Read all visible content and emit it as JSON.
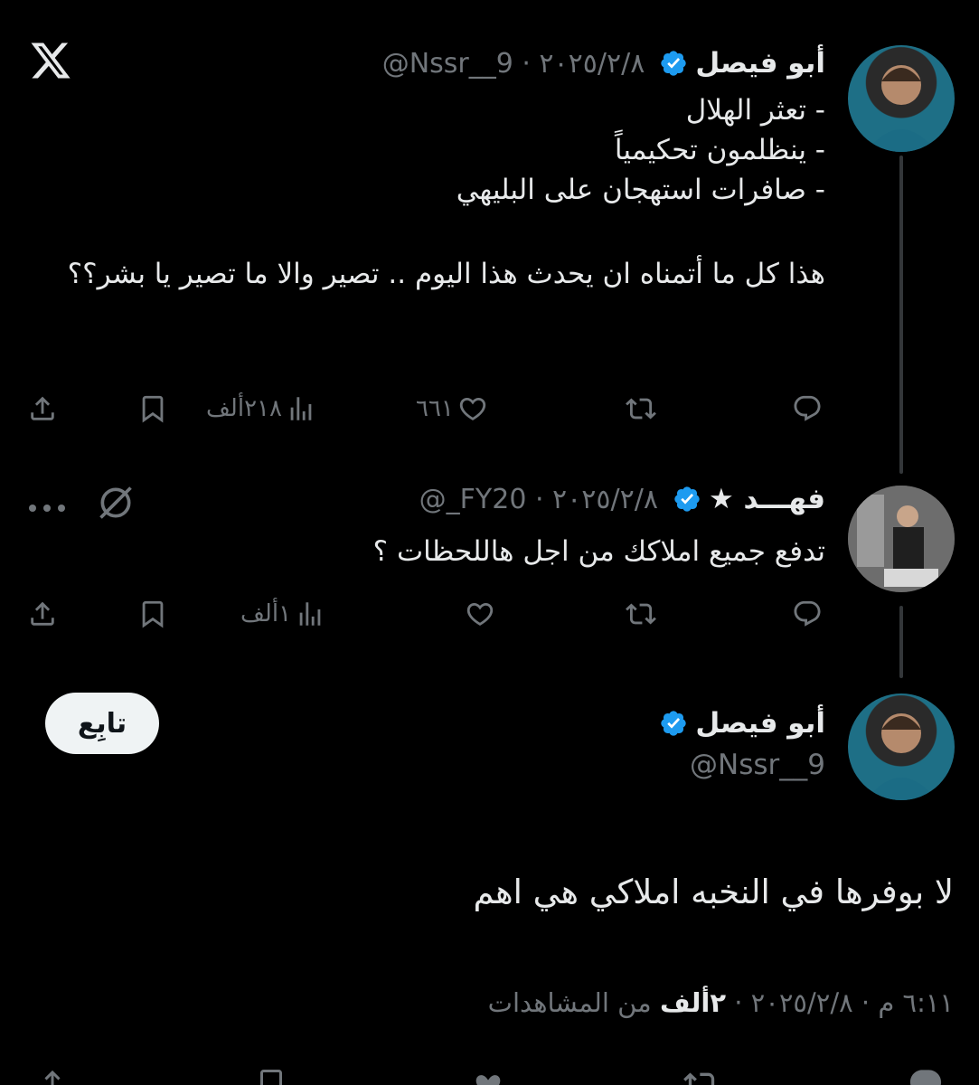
{
  "app": {
    "logo_icon": "x-logo-icon"
  },
  "tweets": [
    {
      "author_name": "أبو فيصل",
      "handle_date": "@Nssr__9 · ٢٠٢٥/٢/٨",
      "lines": [
        "- تعثر الهلال",
        "- ينظلمون تحكيمياً",
        "- صافرات استهجان على البليهي",
        "",
        "هذا كل ما أتمناه ان يحدث هذا اليوم .. تصير والا ما تصير يا بشر؟؟"
      ],
      "likes": "٦٦١",
      "views": "٢١٨ألف"
    },
    {
      "author_name": "فهـــد ★",
      "handle_date": "@_FY20 · ٢٠٢٥/٢/٨",
      "lines": [
        "تدفع جميع املاكك من اجل هاللحظات ؟"
      ],
      "likes": "",
      "views": "١ألف"
    }
  ],
  "main_tweet": {
    "author_name": "أبو فيصل",
    "handle": "@Nssr__9",
    "follow_label": "تابِع",
    "text": "لا بوفرها في النخبه املاكي هي اهم",
    "timestamp": "٦:١١ م · ٢٠٢٥/٢/٨ · ",
    "views_count": "٢ألف",
    "views_label": " من المشاهدات"
  },
  "colors": {
    "background": "#000000",
    "text": "#e7e9ea",
    "muted": "#71767b",
    "verified": "#1d9bf0"
  }
}
